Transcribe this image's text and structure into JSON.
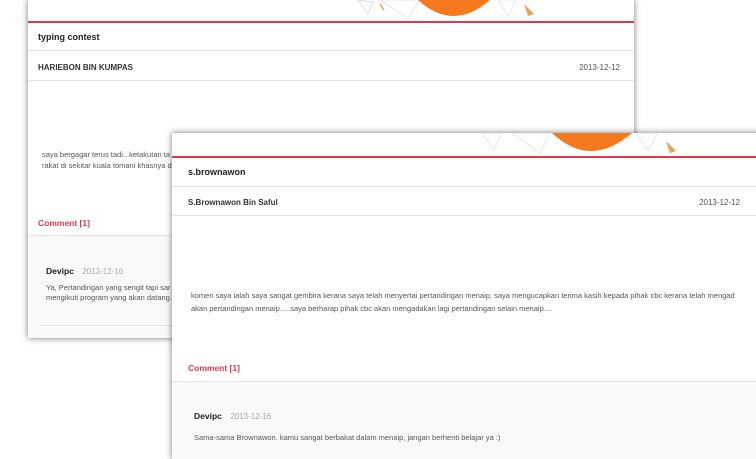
{
  "colors": {
    "accent": "#d93a4f",
    "banner_orange": "#f5791f"
  },
  "post_back": {
    "title": "typing contest",
    "author": "HARIEBON BIN KUMPAS",
    "date": "2013-12-12",
    "body_lines": [
      "saya bergagar terus tadi...ketakutan ta",
      "rakat di sekitar kuala tomani khasnya d"
    ],
    "comment_heading": "Comment  [1]",
    "comment": {
      "author": "Devipc",
      "date": "2013-12-16",
      "lines": [
        "Ya, Pertandingan yang sengit tapi sar",
        "mengikuti program yang akan datang."
      ]
    }
  },
  "post_front": {
    "title": "s.brownawon",
    "author": "S.Brownawon Bin Saful",
    "date": "2013-12-12",
    "body_lines": [
      "komen saya ialah saya sangat gembira kerana saya telah  menyertai pertandingan menaip, saya mengucapkan terima kasih kepada pihak cbc kerana  telah mengad",
      "akan pertandingan menaip.....saya berharap pihak cbc akan mengadakan lagi pertandingan selain menaip...."
    ],
    "comment_heading": "Comment  [1]",
    "comment": {
      "author": "Devipc",
      "date": "2013-12-16",
      "text": "Sama-sama Brownawon. kamu sangat berbakat dalam menaip, jangan berhenti belajar ya :)"
    }
  }
}
